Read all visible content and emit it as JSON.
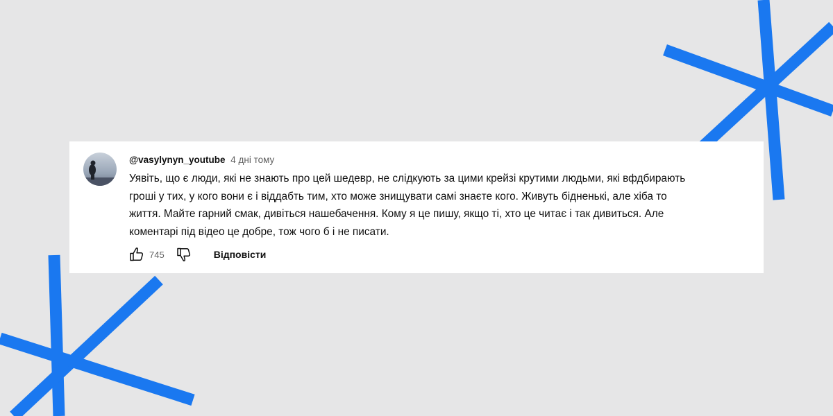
{
  "theme": {
    "background": "#e6e6e7",
    "accent": "#1a78f0",
    "card": "#ffffff"
  },
  "comment": {
    "author": "@vasylynyn_youtube",
    "time": "4 дні тому",
    "lines": [
      "Уявіть, що є люди, які не знають про цей шедевр, не слідкують за цими крейзі крутими людьми, які вфдбирають",
      "гроші у тих, у кого вони є і віддабть тим, хто може знищувати самі знаєте кого. Живуть бідненькі, але хіба то",
      "життя. Майте гарний смак, дивіться нашебачення. Кому я це пишу, якщо ті, хто це читає і так дивиться. Але",
      "коментарі під відео це добре, тож чого б і не писати."
    ],
    "likes": "745",
    "reply_label": "Відповісти"
  },
  "icons": {
    "like": "thumbs-up-icon",
    "dislike": "thumbs-down-icon"
  }
}
